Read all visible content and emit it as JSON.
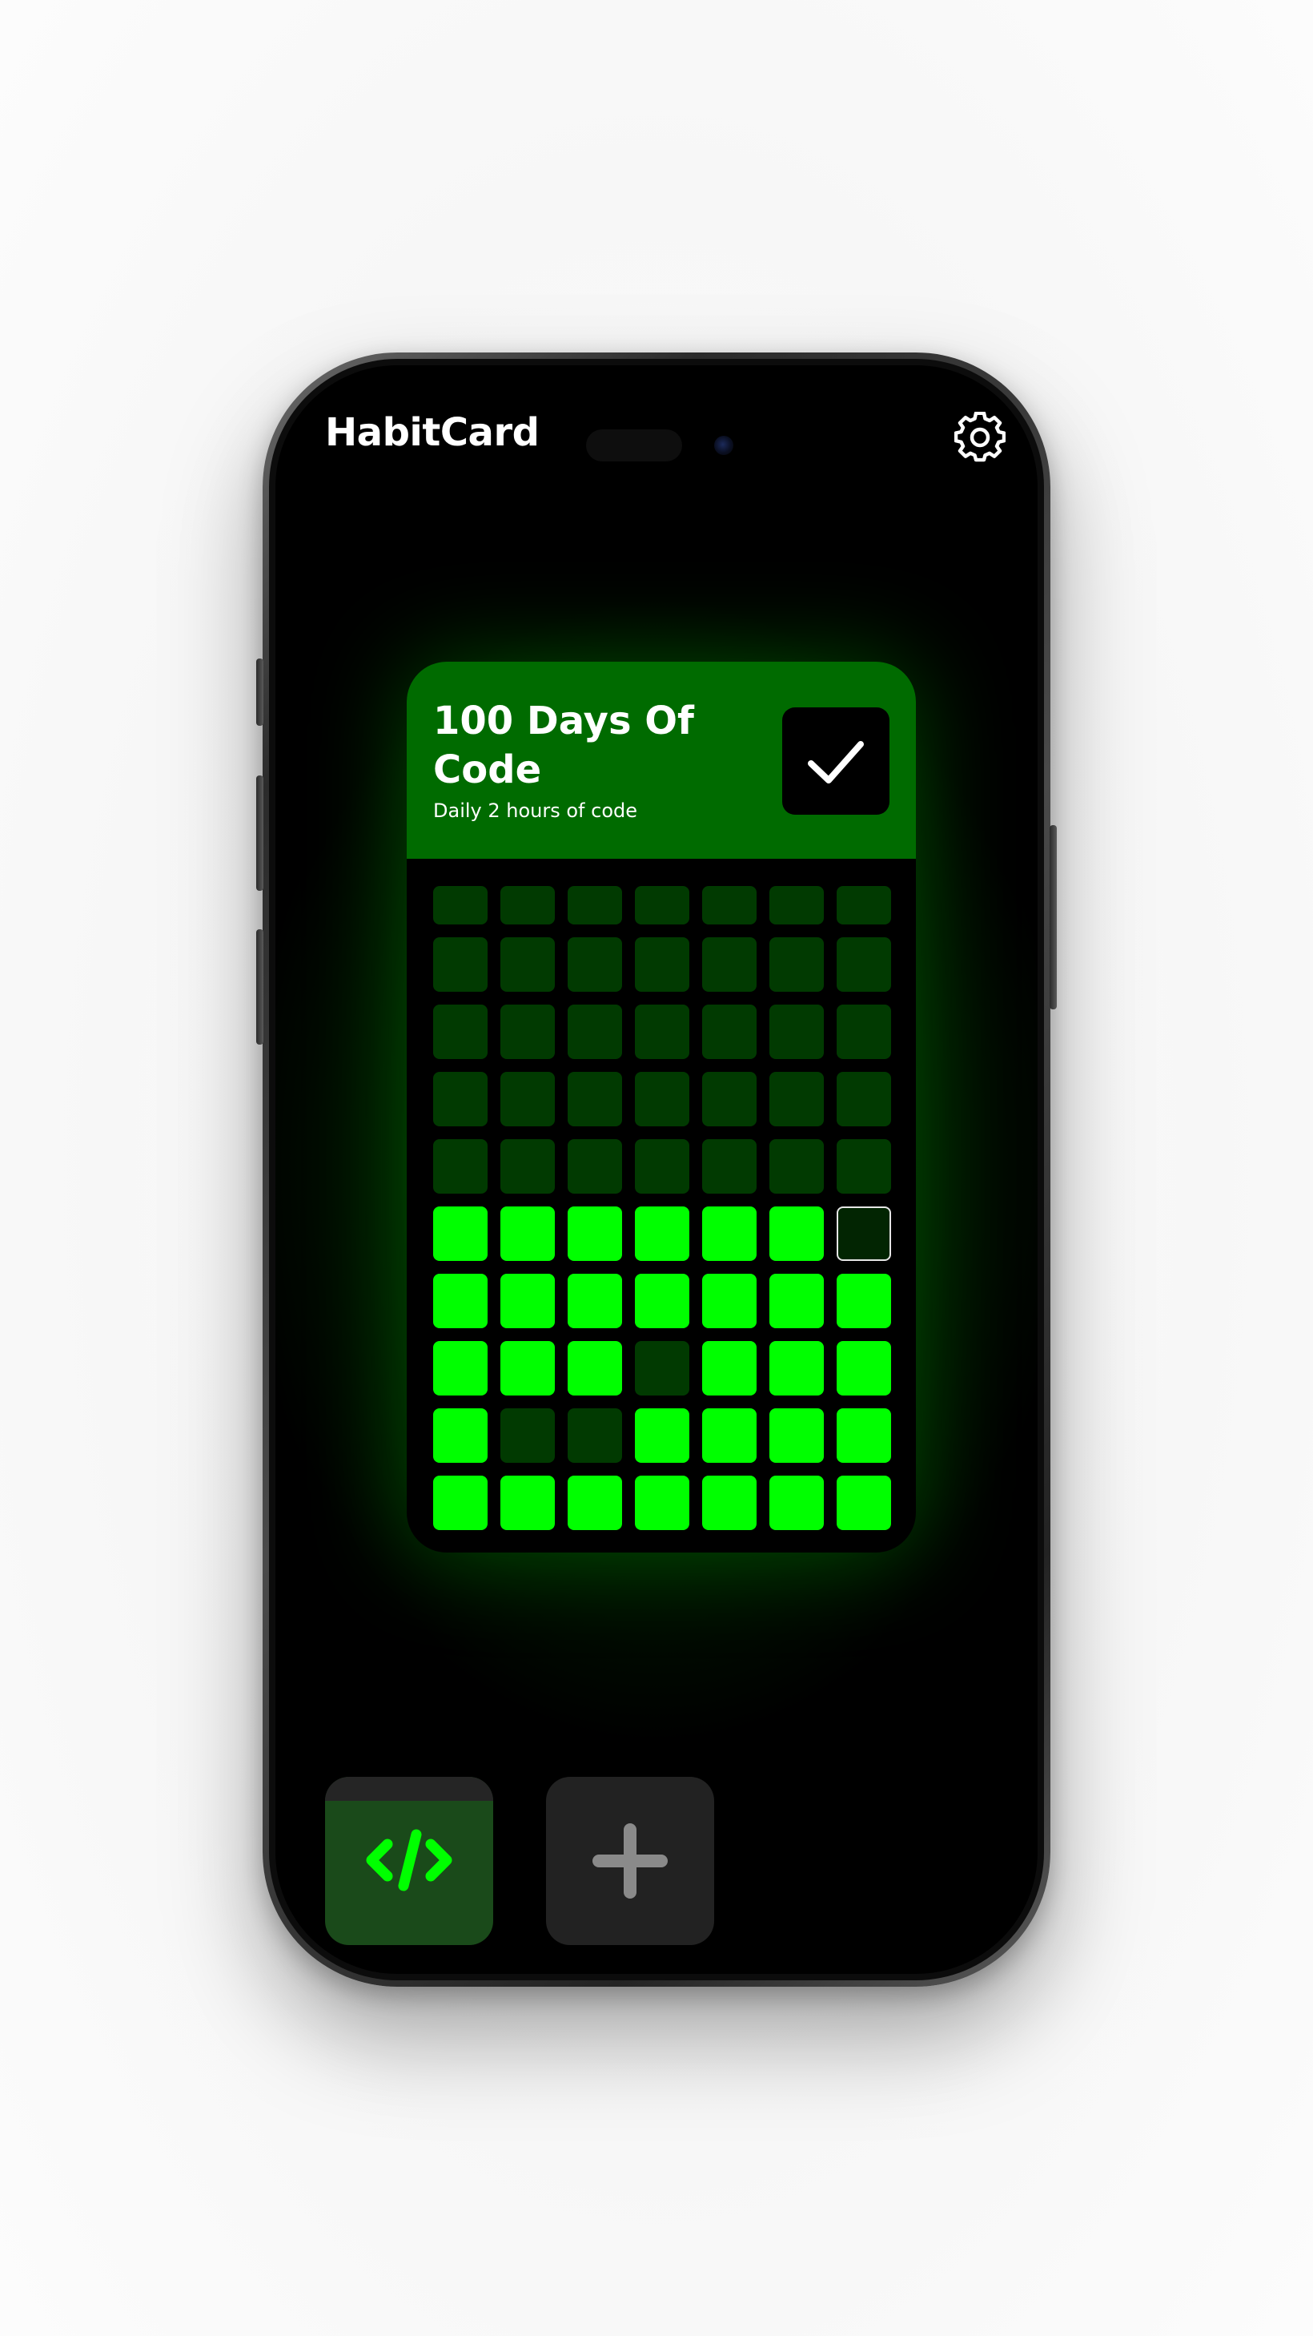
{
  "app": {
    "title": "HabitCard",
    "settings_icon": "gear-icon"
  },
  "habit_card": {
    "title": "100 Days Of Code",
    "subtitle": "Daily 2 hours of code",
    "check_icon": "checkmark-icon",
    "header_color": "#006b00",
    "done_color": "#00ff00",
    "empty_color": "#013a01",
    "grid": [
      [
        "empty",
        "empty",
        "empty",
        "empty",
        "empty",
        "empty",
        "empty"
      ],
      [
        "empty",
        "empty",
        "empty",
        "empty",
        "empty",
        "empty",
        "empty"
      ],
      [
        "empty",
        "empty",
        "empty",
        "empty",
        "empty",
        "empty",
        "empty"
      ],
      [
        "empty",
        "empty",
        "empty",
        "empty",
        "empty",
        "empty",
        "empty"
      ],
      [
        "empty",
        "empty",
        "empty",
        "empty",
        "empty",
        "empty",
        "empty"
      ],
      [
        "done",
        "done",
        "done",
        "done",
        "done",
        "done",
        "today"
      ],
      [
        "done",
        "done",
        "done",
        "done",
        "done",
        "done",
        "done"
      ],
      [
        "done",
        "done",
        "done",
        "empty",
        "done",
        "done",
        "done"
      ],
      [
        "done",
        "empty",
        "empty",
        "done",
        "done",
        "done",
        "done"
      ],
      [
        "done",
        "done",
        "done",
        "done",
        "done",
        "done",
        "done"
      ]
    ]
  },
  "habit_tabs": [
    {
      "icon": "code-icon",
      "selected": true
    },
    {
      "icon": "plus-icon",
      "selected": false
    }
  ],
  "colors": {
    "accent": "#00ff00",
    "background": "#000000"
  }
}
